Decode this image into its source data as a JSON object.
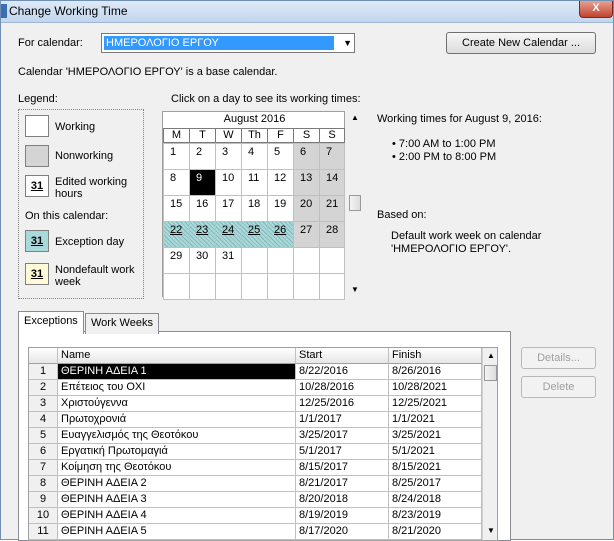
{
  "window": {
    "title": "Change Working Time",
    "close_label": "X"
  },
  "calendar_select": {
    "label": "For calendar:",
    "value": "ΗΜΕΡΟΛΟΓΙΟ ΕΡΓΟΥ",
    "create_button": "Create New Calendar ..."
  },
  "base_note": "Calendar 'ΗΜΕΡΟΛΟΓΙΟ ΕΡΓΟΥ' is a base calendar.",
  "legend": {
    "title": "Legend:",
    "working": "Working",
    "nonworking": "Nonworking",
    "edited_hours": "Edited working hours",
    "on_this_calendar": "On this calendar:",
    "exception_day": "Exception day",
    "nondefault_week": "Nondefault work week",
    "swatch_number": "31"
  },
  "calendar": {
    "instruction": "Click on a day to see its working times:",
    "month": "August 2016",
    "weekdays": [
      "M",
      "T",
      "W",
      "Th",
      "F",
      "S",
      "S"
    ],
    "weeks": [
      [
        "1",
        "2",
        "3",
        "4",
        "5",
        "6",
        "7"
      ],
      [
        "8",
        "9",
        "10",
        "11",
        "12",
        "13",
        "14"
      ],
      [
        "15",
        "16",
        "17",
        "18",
        "19",
        "20",
        "21"
      ],
      [
        "22",
        "23",
        "24",
        "25",
        "26",
        "27",
        "28"
      ],
      [
        "29",
        "30",
        "31",
        "",
        "",
        "",
        ""
      ],
      [
        "",
        "",
        "",
        "",
        "",
        "",
        ""
      ]
    ]
  },
  "working_times": {
    "heading": "Working times for August 9, 2016:",
    "times": [
      "7:00 AM to 1:00 PM",
      "2:00 PM to 8:00 PM"
    ],
    "based_on_label": "Based on:",
    "based_on_text_1": "Default work week on calendar",
    "based_on_text_2": "'ΗΜΕΡΟΛΟΓΙΟ ΕΡΓΟΥ'."
  },
  "tabs": {
    "exceptions": "Exceptions",
    "work_weeks": "Work Weeks"
  },
  "table": {
    "headers": {
      "name": "Name",
      "start": "Start",
      "finish": "Finish"
    },
    "rows": [
      {
        "n": "1",
        "name": "ΘΕΡΙΝΗ ΑΔΕΙΑ 1",
        "start": "8/22/2016",
        "finish": "8/26/2016"
      },
      {
        "n": "2",
        "name": "Επέτειος του ΟΧΙ",
        "start": "10/28/2016",
        "finish": "10/28/2021"
      },
      {
        "n": "3",
        "name": "Χριστούγεννα",
        "start": "12/25/2016",
        "finish": "12/25/2021"
      },
      {
        "n": "4",
        "name": "Πρωτοχρονιά",
        "start": "1/1/2017",
        "finish": "1/1/2021"
      },
      {
        "n": "5",
        "name": "Ευαγγελισμός της Θεοτόκου",
        "start": "3/25/2017",
        "finish": "3/25/2021"
      },
      {
        "n": "6",
        "name": "Εργατική Πρωτομαγιά",
        "start": "5/1/2017",
        "finish": "5/1/2021"
      },
      {
        "n": "7",
        "name": "Κοίμηση της Θεοτόκου",
        "start": "8/15/2017",
        "finish": "8/15/2021"
      },
      {
        "n": "8",
        "name": "ΘΕΡΙΝΗ ΑΔΕΙΑ 2",
        "start": "8/21/2017",
        "finish": "8/25/2017"
      },
      {
        "n": "9",
        "name": "ΘΕΡΙΝΗ ΑΔΕΙΑ 3",
        "start": "8/20/2018",
        "finish": "8/24/2018"
      },
      {
        "n": "10",
        "name": "ΘΕΡΙΝΗ ΑΔΕΙΑ 4",
        "start": "8/19/2019",
        "finish": "8/23/2019"
      },
      {
        "n": "11",
        "name": "ΘΕΡΙΝΗ ΑΔΕΙΑ 5",
        "start": "8/17/2020",
        "finish": "8/21/2020"
      }
    ]
  },
  "side_buttons": {
    "details": "Details...",
    "delete": "Delete"
  },
  "colors": {
    "selection": "#3399ff",
    "nonworking": "#d4d4d4",
    "exception": "#a8dadc"
  }
}
